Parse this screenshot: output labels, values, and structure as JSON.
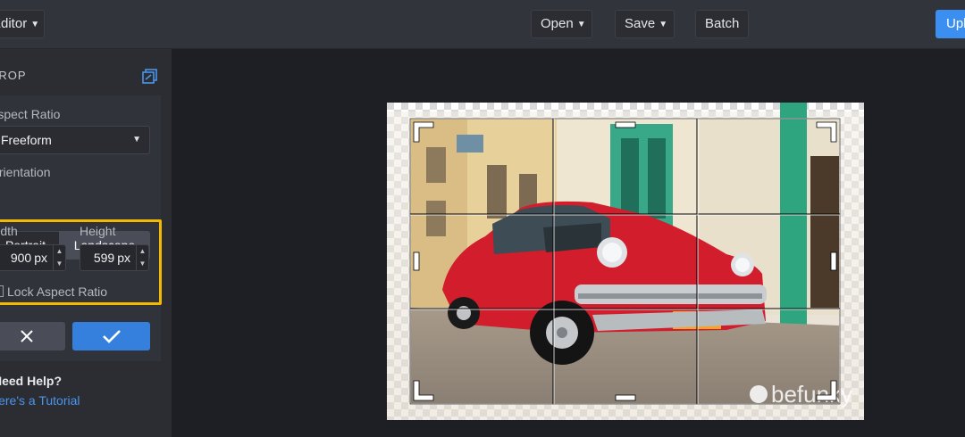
{
  "topbar": {
    "editor_label": "Editor",
    "open_label": "Open",
    "save_label": "Save",
    "batch_label": "Batch",
    "upload_label": "Upload",
    "chevron": "chevron-down-icon"
  },
  "sidebar": {
    "section_title": "CROP",
    "aspect_ratio_label": "Aspect Ratio",
    "aspect_ratio_value": "Freeform",
    "orientation_label": "Orientation",
    "orientation_options": [
      "Portrait",
      "Landscape"
    ],
    "orientation_selected": "Landscape",
    "width_label": "Width",
    "width_value": "900",
    "height_label": "Height",
    "height_value": "599",
    "unit": "px",
    "lock_label": "Lock Aspect Ratio",
    "lock_checked": false,
    "help_title": "Need Help?",
    "help_link": "Here's a Tutorial"
  },
  "canvas": {
    "watermark": "befunky",
    "accent_color": "#f5b800",
    "apply_color": "#3580dc"
  }
}
